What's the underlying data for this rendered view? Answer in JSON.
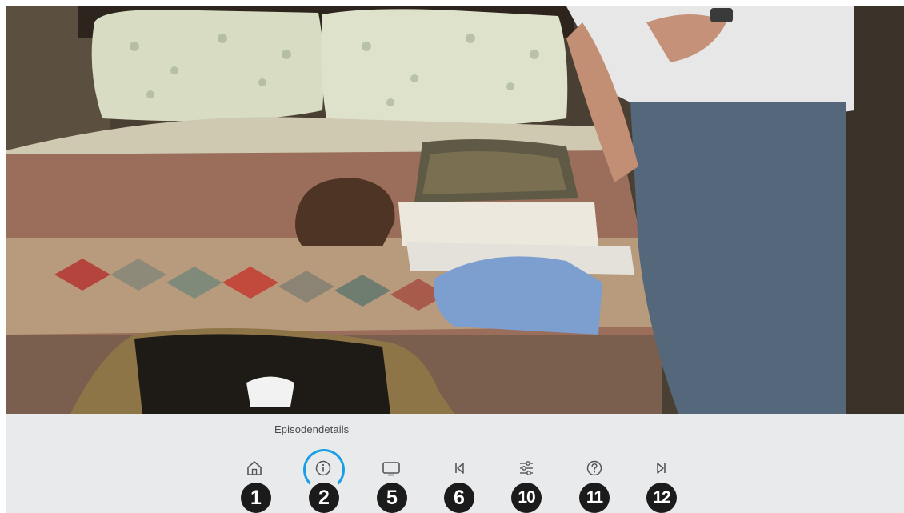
{
  "player": {
    "focused_item_label": "Episodendetails"
  },
  "controls": [
    {
      "id": "home",
      "icon": "home-icon",
      "badge": "1"
    },
    {
      "id": "info",
      "icon": "info-icon",
      "badge": "2",
      "focused": true
    },
    {
      "id": "screen",
      "icon": "screen-icon",
      "badge": "5"
    },
    {
      "id": "skip-back",
      "icon": "skip-back-icon",
      "badge": "6"
    },
    {
      "id": "settings",
      "icon": "sliders-icon",
      "badge": "10"
    },
    {
      "id": "help",
      "icon": "help-icon",
      "badge": "11"
    },
    {
      "id": "skip-forward",
      "icon": "skip-forward-icon",
      "badge": "12"
    }
  ],
  "colors": {
    "focus_ring": "#1a9ee5",
    "bar_background": "#e9eaeb",
    "badge_background": "#1b1b1b",
    "icon_stroke": "#555555"
  }
}
